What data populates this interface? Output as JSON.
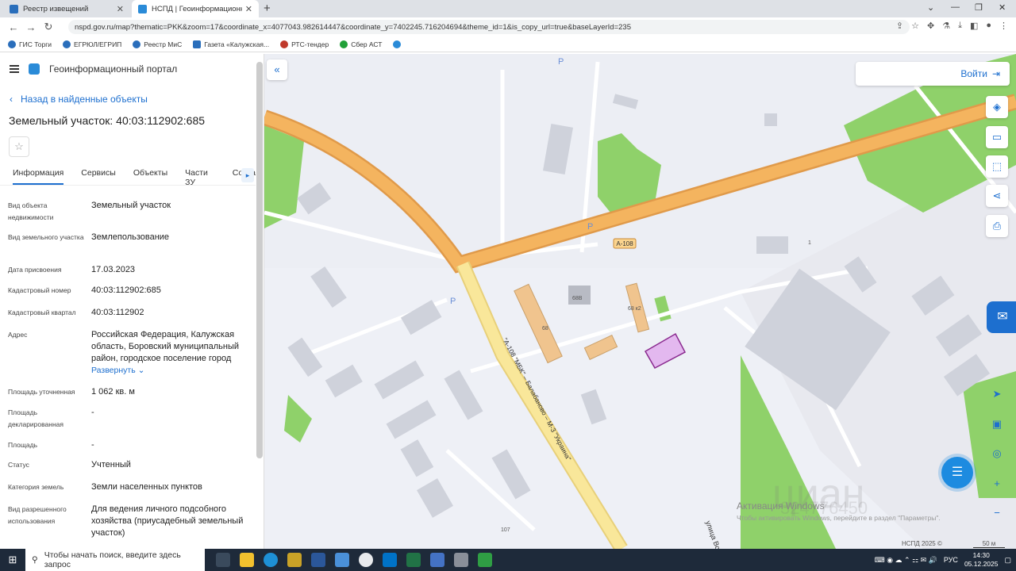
{
  "browser": {
    "tabs": [
      {
        "title": "Реестр извещений"
      },
      {
        "title": "НСПД | Геоинформационный п"
      }
    ],
    "url": "nspd.gov.ru/map?thematic=PKK&zoom=17&coordinate_x=4077043.982614447&coordinate_y=7402245.716204694&theme_id=1&is_copy_url=true&baseLayerId=235",
    "bookmarks": [
      "ГИС Торги",
      "ЕГРЮЛ/ЕГРИП",
      "Реестр МиС",
      "Газета «Калужская...",
      "РТС-тендер",
      "Сбер АСТ"
    ]
  },
  "panel": {
    "portal_title": "Геоинформационный портал",
    "back_label": "Назад в найденные объекты",
    "title": "Земельный участок: 40:03:112902:685",
    "tabs": [
      "Информация",
      "Сервисы",
      "Объекты",
      "Части ЗУ",
      "Соста"
    ],
    "fields": [
      {
        "label": "Вид объекта недвижимости",
        "value": "Земельный участок"
      },
      {
        "label": "Вид земельного участка",
        "value": "Землепользование"
      },
      {
        "label": "Дата присвоения",
        "value": "17.03.2023"
      },
      {
        "label": "Кадастровый номер",
        "value": "40:03:112902:685"
      },
      {
        "label": "Кадастровый квартал",
        "value": "40:03:112902"
      },
      {
        "label": "Адрес",
        "value": "Российская Федерация, Калужская область, Боровский муниципальный район, городское поселение город"
      },
      {
        "label": "Площадь уточненная",
        "value": "1 062 кв. м"
      },
      {
        "label": "Площадь декларированная",
        "value": "-"
      },
      {
        "label": "Площадь",
        "value": "-"
      },
      {
        "label": "Статус",
        "value": "Учтенный"
      },
      {
        "label": "Категория земель",
        "value": "Земли населенных пунктов"
      },
      {
        "label": "Вид разрешенного использования",
        "value": "Для ведения личного подсобного хозяйства (приусадебный земельный участок)"
      }
    ],
    "expand_label": "Развернуть"
  },
  "map": {
    "login_label": "Войти",
    "road_badge": "А-108",
    "road_label": "\"А-108 \"МБК\" – Балабаново – М-3 \"Украина\"",
    "street_label": "улица Во",
    "building_labels": [
      "68В",
      "68 к2",
      "68",
      "1",
      "107"
    ],
    "parking": "P",
    "activation_title": "Активация Windows",
    "activation_text": "Чтобы активировать Windows, перейдите в раздел \"Параметры\".",
    "watermark": "циан",
    "watermark_phone": "324776450",
    "copyright": "НСПД 2025 ©",
    "scale": "50 м"
  },
  "taskbar": {
    "search_placeholder": "Чтобы начать поиск, введите здесь запрос",
    "lang": "РУС",
    "time": "14:30",
    "date": "05.12.2025"
  },
  "colors": {
    "accent": "#1d6fcf",
    "road": "#f4b45f",
    "parcel": "#e3b8ef",
    "green": "#8fd16a"
  }
}
